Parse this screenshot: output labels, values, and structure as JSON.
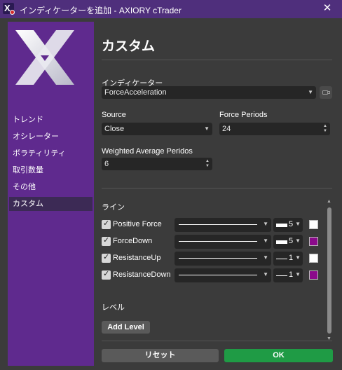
{
  "window": {
    "title": "インディケーターを追加 - AXIORY cTrader",
    "close_glyph": "✕"
  },
  "sidebar": {
    "items": [
      {
        "label": "トレンド"
      },
      {
        "label": "オシレーター"
      },
      {
        "label": "ボラティリティ"
      },
      {
        "label": "取引数量"
      },
      {
        "label": "その他"
      },
      {
        "label": "カスタム",
        "active": true
      }
    ]
  },
  "main": {
    "title": "カスタム",
    "indicator": {
      "label": "インディケーター",
      "value": "ForceAcceleration"
    },
    "source": {
      "label": "Source",
      "value": "Close"
    },
    "force_periods": {
      "label": "Force Periods",
      "value": "24"
    },
    "weighted_average": {
      "label": "Weighted Average Peridos",
      "value": "6"
    },
    "lines_title": "ライン",
    "lines": [
      {
        "name": "Positive Force",
        "width": "5",
        "color": "#ffffff",
        "checked": true
      },
      {
        "name": "ForceDown",
        "width": "5",
        "color": "#8b0a8b",
        "checked": true
      },
      {
        "name": "ResistanceUp",
        "width": "1",
        "color": "#ffffff",
        "checked": true
      },
      {
        "name": "ResistanceDown",
        "width": "1",
        "color": "#8b0a8b",
        "checked": true
      }
    ],
    "levels_title": "レベル",
    "add_level": "Add Level"
  },
  "footer": {
    "reset": "リセット",
    "ok": "OK"
  },
  "glyphs": {
    "dropdown": "▼",
    "spin_up": "▲",
    "spin_down": "▼",
    "check": "✓"
  },
  "colors": {
    "titlebar": "#4f2f7c",
    "sidebar": "#5f2a8e",
    "ok": "#1f9b45"
  }
}
